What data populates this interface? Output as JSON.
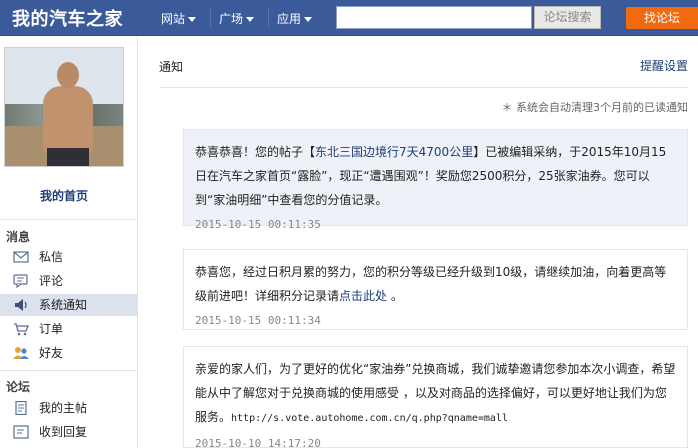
{
  "header": {
    "logo": "我的汽车之家",
    "nav": [
      {
        "label": "网站"
      },
      {
        "label": "广场"
      },
      {
        "label": "应用"
      }
    ],
    "search": {
      "value": "",
      "placeholder": ""
    },
    "search_button": "论坛搜索",
    "redirect_button": "找论坛"
  },
  "sidebar": {
    "home_link": "我的首页",
    "messages_title": "消息",
    "messages": [
      {
        "label": "私信",
        "icon": "envelope-icon"
      },
      {
        "label": "评论",
        "icon": "comment-icon"
      },
      {
        "label": "系统通知",
        "icon": "speaker-icon"
      },
      {
        "label": "订单",
        "icon": "cart-icon"
      },
      {
        "label": "好友",
        "icon": "friends-icon"
      }
    ],
    "forum_title": "论坛",
    "forum": [
      {
        "label": "我的主帖",
        "icon": "document-icon"
      },
      {
        "label": "收到回复",
        "icon": "reply-icon"
      }
    ]
  },
  "main": {
    "title": "通知",
    "settings_link": "提醒设置",
    "auto_clear_note": "＊ 系统会自动清理3个月前的已读通知",
    "notices": [
      {
        "text_before": "恭喜恭喜！您的帖子【",
        "link": "东北三国边境行7天4700公里",
        "text_after": "】已被编辑采纳，于2015年10月15日在汽车之家首页“露脸”，现正“遭遇围观”！奖励您2500积分，25张家油券。您可以到“家油明细”中查看您的分值记录。",
        "time": "2015-10-15 00:11:35"
      },
      {
        "text_before": "恭喜您，经过日积月累的努力，您的积分等级已经升级到10级，请继续加油，向着更高等级前进吧！详细积分记录请",
        "link": "点击此处",
        "text_after": " 。",
        "time": "2015-10-15 00:11:34"
      },
      {
        "text_before": "亲爱的家人们，为了更好的优化“家油券”兑换商城，我们诚挚邀请您参加本次小调查，希望能从中了解您对于兑换商城的使用感受 ，以及对商品的选择偏好，可以更好地让我们为您服务。",
        "link": "http://s.vote.autohome.com.cn/q.php?qname=mall",
        "text_after": "",
        "time": "2015-10-10 14:17:20"
      }
    ]
  },
  "colors": {
    "topbar": "#3b5a9a",
    "accent_orange": "#f26a10",
    "link": "#1d3f7a",
    "active_bg": "#dbe2ee"
  }
}
